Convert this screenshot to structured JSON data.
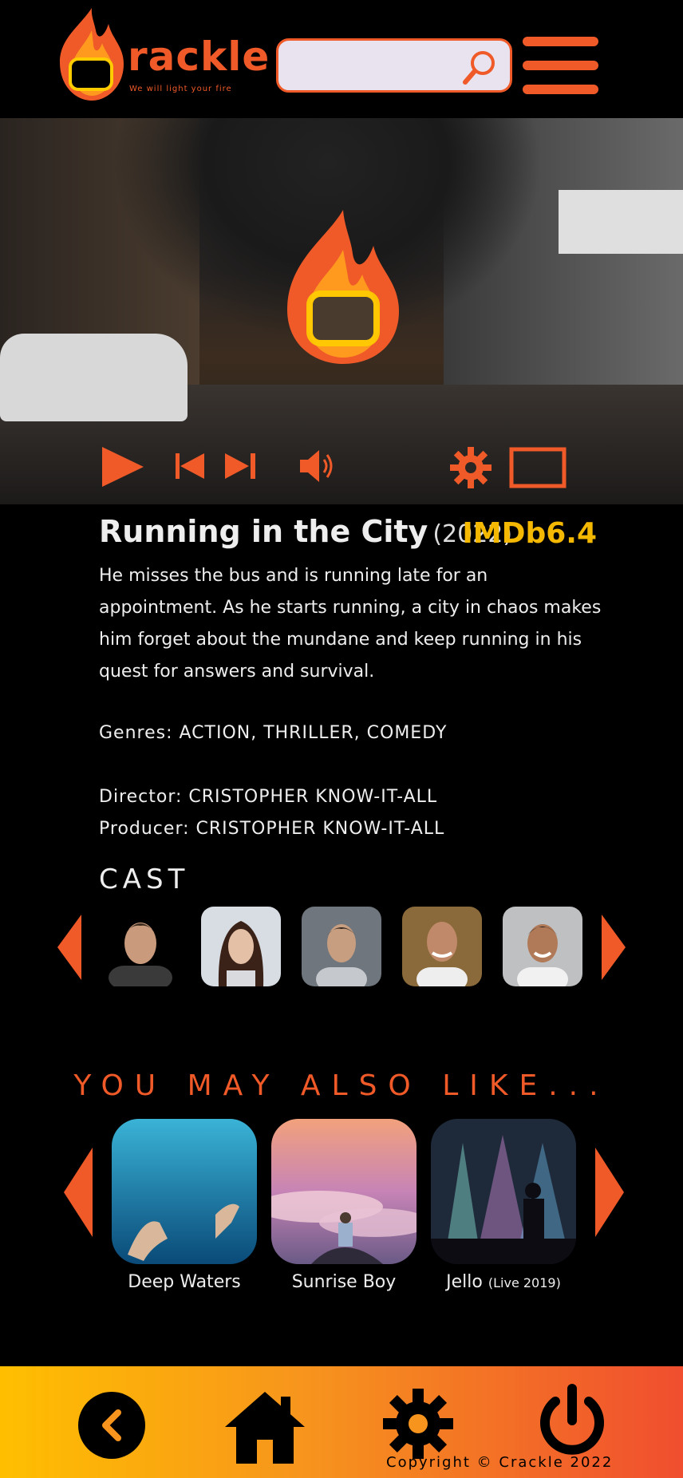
{
  "header": {
    "brand": "rackle",
    "tagline": "We will light your fire",
    "search_placeholder": "",
    "search_icon": "search-icon",
    "menu_icon": "hamburger-menu-icon"
  },
  "player": {
    "controls": [
      "play-icon",
      "previous-icon",
      "next-icon",
      "volume-icon",
      "settings-icon",
      "fullscreen-icon"
    ]
  },
  "movie": {
    "title": "Running in the City",
    "year": "(2022)",
    "imdb": "IMDb6.4",
    "description": "He misses the bus and is running late for an appointment. As he starts running, a city in chaos makes him forget about the mundane and keep running in his quest for answers and survival.",
    "genres": "Genres: ACTION, THRILLER, COMEDY",
    "director": "Director: CRISTOPHER KNOW-IT-ALL",
    "producer": "Producer: CRISTOPHER KNOW-IT-ALL"
  },
  "cast": {
    "heading": "CAST",
    "count": 5
  },
  "recommendations": {
    "heading": "YOU MAY ALSO LIKE...",
    "items": [
      {
        "title": "Deep Waters",
        "suffix": ""
      },
      {
        "title": "Sunrise Boy",
        "suffix": ""
      },
      {
        "title": "Jello",
        "suffix": "(Live 2019)"
      }
    ]
  },
  "footer": {
    "buttons": [
      "back-icon",
      "home-icon",
      "settings-icon",
      "power-icon"
    ],
    "copyright": "Copyright © Crackle 2022"
  },
  "colors": {
    "accent": "#f05a28",
    "imdb": "#f5b800",
    "background": "#000000"
  }
}
